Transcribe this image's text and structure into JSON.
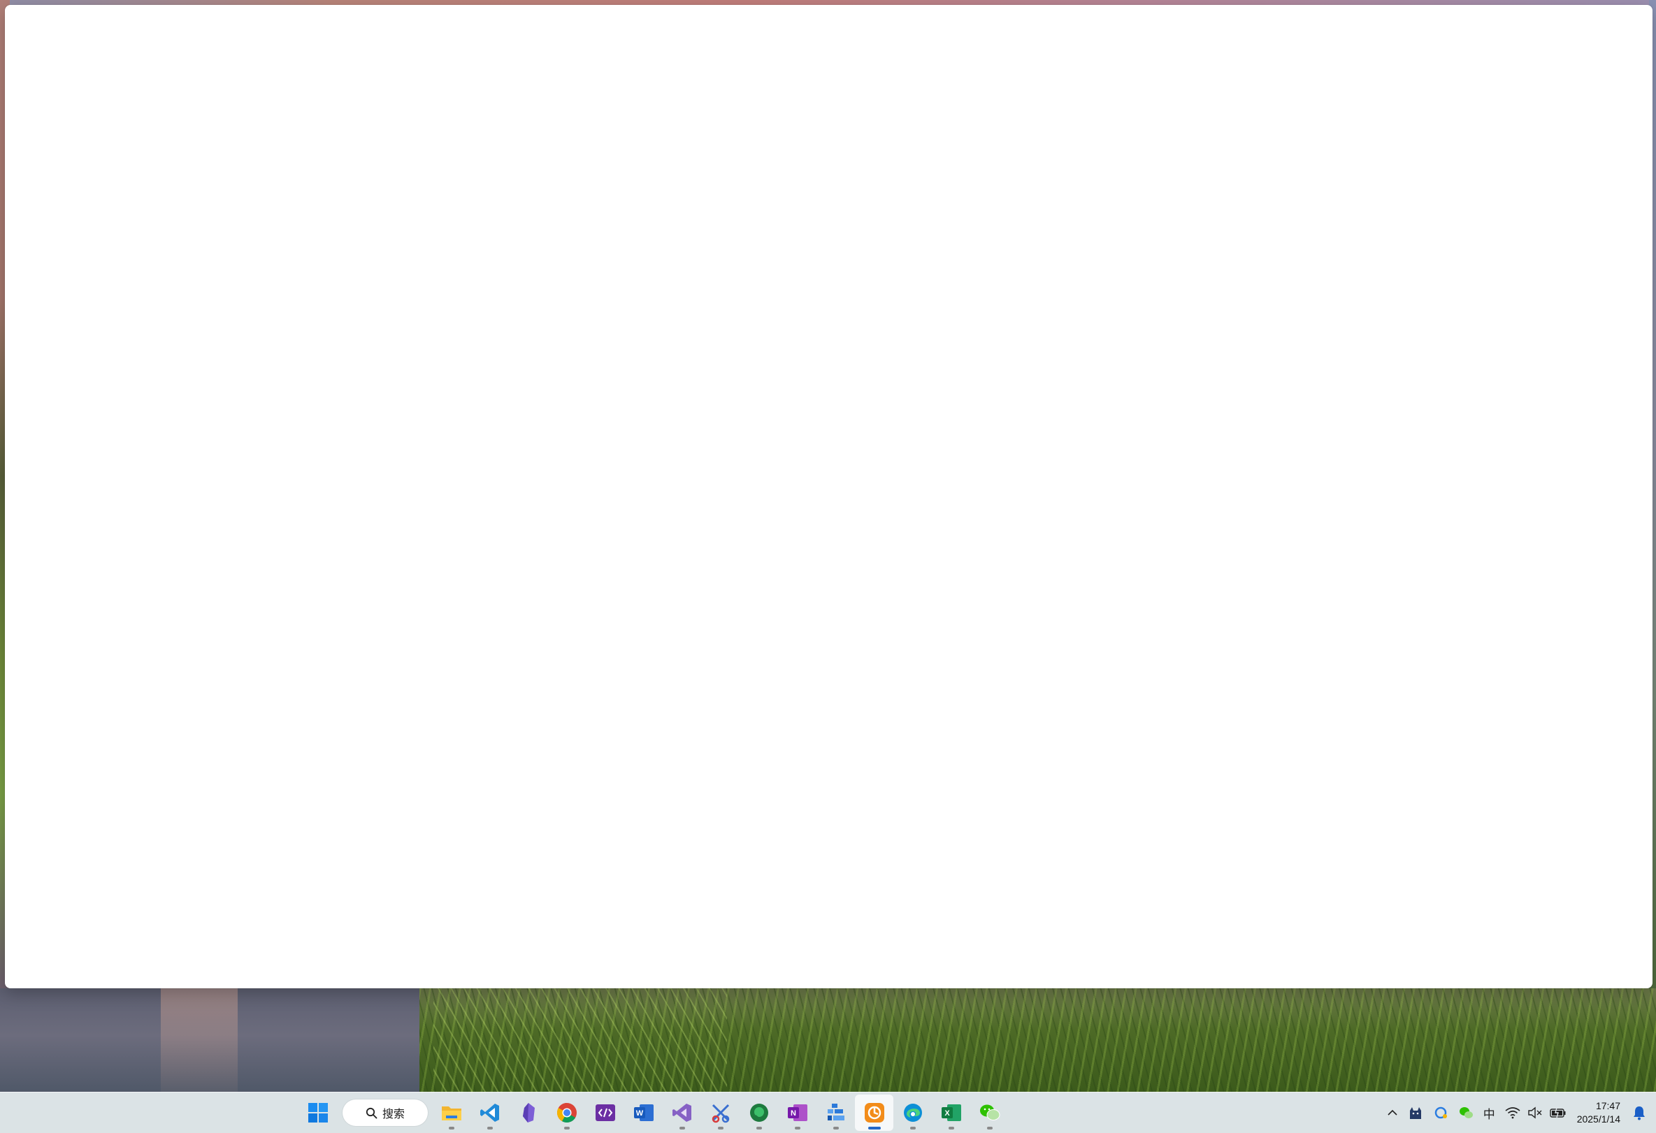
{
  "window": {
    "title": ""
  },
  "taskbar": {
    "search": {
      "label": "搜索",
      "icon": "search-icon"
    },
    "apps": [
      {
        "name": "file-explorer",
        "icon": "folder-icon",
        "running": true,
        "active": false
      },
      {
        "name": "vscode",
        "icon": "vscode-icon",
        "running": true,
        "active": false
      },
      {
        "name": "obsidian",
        "icon": "obsidian-icon",
        "running": false,
        "active": false
      },
      {
        "name": "chrome",
        "icon": "chrome-icon",
        "running": true,
        "active": false
      },
      {
        "name": "dev-tool",
        "icon": "code-tag-icon",
        "running": false,
        "active": false
      },
      {
        "name": "word",
        "icon": "word-icon",
        "running": false,
        "active": false
      },
      {
        "name": "visual-studio",
        "icon": "visual-studio-icon",
        "running": true,
        "active": false
      },
      {
        "name": "snipping-tool",
        "icon": "scissors-icon",
        "running": true,
        "active": false
      },
      {
        "name": "chat-app",
        "icon": "chat-bubble-icon",
        "running": true,
        "active": false
      },
      {
        "name": "onenote",
        "icon": "onenote-icon",
        "running": true,
        "active": false
      },
      {
        "name": "stacked-app",
        "icon": "blocks-icon",
        "running": true,
        "active": false
      },
      {
        "name": "orange-app",
        "icon": "orange-app-icon",
        "running": true,
        "active": true
      },
      {
        "name": "edge",
        "icon": "edge-icon",
        "running": true,
        "active": false
      },
      {
        "name": "excel",
        "icon": "excel-icon",
        "running": true,
        "active": false
      },
      {
        "name": "wechat",
        "icon": "wechat-icon",
        "running": true,
        "active": false
      }
    ],
    "tray": {
      "ime": "中",
      "time": "17:47",
      "date": "2025/1/14"
    }
  },
  "colors": {
    "taskbar_bg": "#e2e9ec",
    "active_indicator": "#2468c9",
    "window_bg": "#ffffff"
  }
}
